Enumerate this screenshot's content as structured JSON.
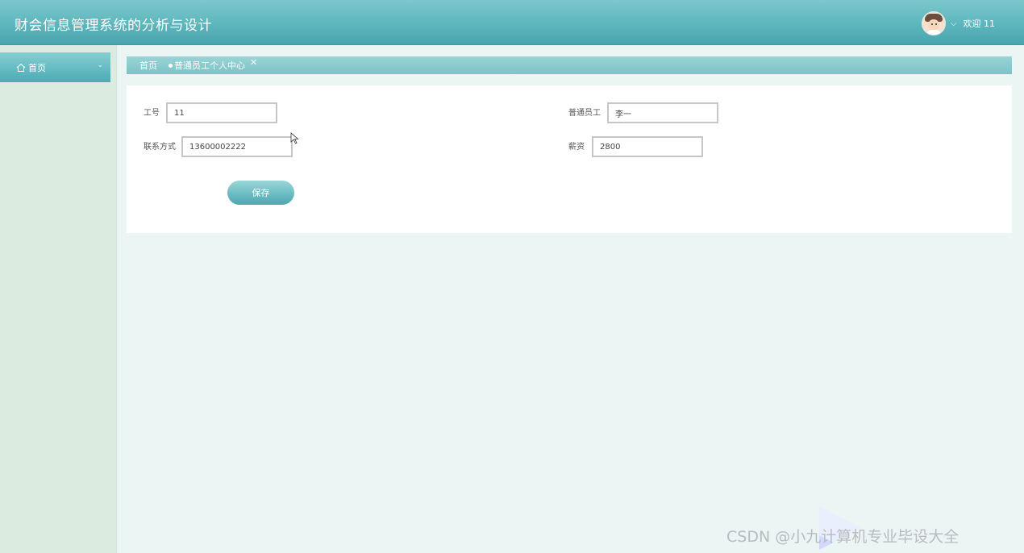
{
  "header": {
    "title": "财会信息管理系统的分析与设计",
    "welcome": "欢迎 11"
  },
  "sidebar": {
    "items": [
      {
        "label": "首页"
      }
    ]
  },
  "tabs": {
    "home": "首页",
    "active": "普通员工个人中心",
    "close": "✕"
  },
  "form": {
    "employee_no_label": "工号",
    "employee_no_value": "11",
    "employee_name_label": "普通员工",
    "employee_name_value": "李一",
    "contact_label": "联系方式",
    "contact_value": "13600002222",
    "salary_label": "薪资",
    "salary_value": "2800",
    "save_label": "保存"
  },
  "watermark": {
    "text": "CSDN @小九计算机专业毕设大全"
  },
  "icons": {
    "home": "home-icon",
    "chevron": "chevron-down-icon",
    "close": "close-icon",
    "avatar": "avatar"
  }
}
